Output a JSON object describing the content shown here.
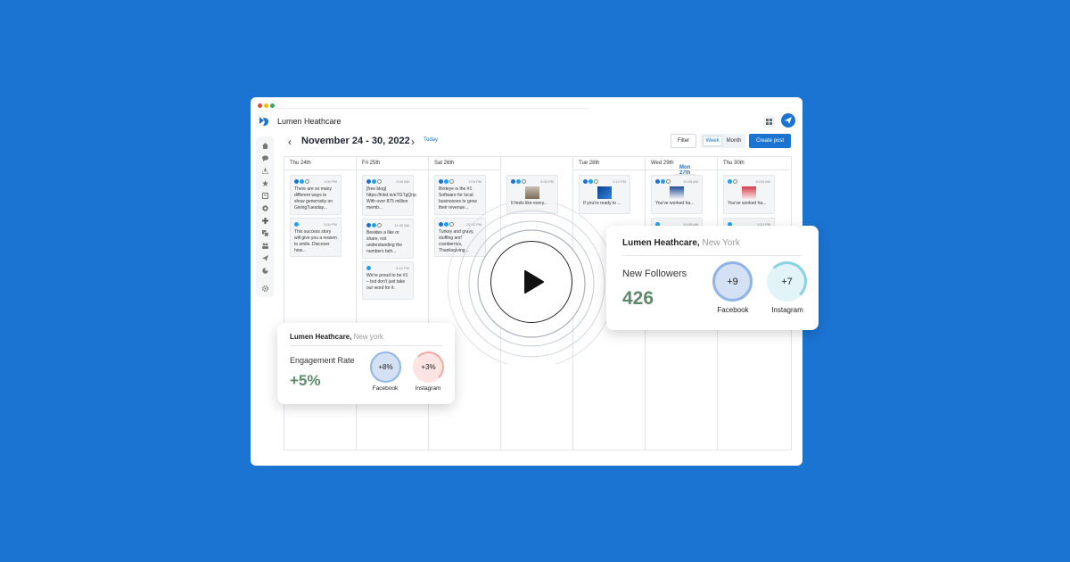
{
  "window": {
    "title": "Lumen Heathcare"
  },
  "toolbar": {
    "date_range": "November 24 - 30, 2022",
    "today_label": "Today",
    "filter_label": "Filter",
    "week_label": "Week",
    "month_label": "Month",
    "create_label": "Create post"
  },
  "days": [
    {
      "label": "Thu  24th"
    },
    {
      "label": "Fri  25th"
    },
    {
      "label": "Sat  26th"
    },
    {
      "label": "Mon  27th"
    },
    {
      "label": "Tue  28th"
    },
    {
      "label": "Wed  29th"
    },
    {
      "label": "Thu  30th"
    }
  ],
  "posts": {
    "thu24_1": {
      "time": "1:00 PM",
      "text": "There are so many different ways to show generosity on GivingTuesday..."
    },
    "thu24_2": {
      "time": "3:00 PM",
      "text": "This success story will give you a reason to smile. Discover how..."
    },
    "fri25_1": {
      "time": "9:00 AM",
      "text": "[free blog] https://lnkd.in/eTGTgQnp With over 875 million memb..."
    },
    "fri25_2": {
      "time": "11:30 AM",
      "text": "Besides a like or share, not understanding the numbers beh..."
    },
    "fri25_3": {
      "time": "3:10 PM",
      "text": "We're proud to be #1 – but don't just take our word for it."
    },
    "sat26_1": {
      "time": "1:09 PM",
      "text": "Birdeye is the #1 Software for local businesses to grow their revenue..."
    },
    "sat26_2": {
      "time": "10:00 PM",
      "text": "Turkey and gravy, stuffing and cranberries, Thanksgiving..."
    },
    "mon27_1": {
      "time": "3:30 PM",
      "text": "It feels like every..."
    },
    "tue28_1": {
      "time": "1:10 PM",
      "text": "If you're ready to ..."
    },
    "wed29_1": {
      "time": "10:08 AM",
      "text": "You've worked ha..."
    },
    "wed29_2": {
      "time": "10:09 AM",
      "text": ""
    },
    "thu30_1": {
      "time": "10:00 AM",
      "text": "You've worked ha..."
    },
    "thu30_2": {
      "time": "1:03 PM",
      "text": ""
    }
  },
  "followers_card": {
    "business": "Lumen Heathcare,",
    "location": " New York",
    "metric_label": "New Followers",
    "metric_value": "426",
    "facebook_value": "+9",
    "facebook_label": "Facebook",
    "instagram_value": "+7",
    "instagram_label": "Instagram"
  },
  "engagement_card": {
    "business": "Lumen Heathcare,",
    "location": " New york",
    "metric_label": "Engagement Rate",
    "metric_value": "+5%",
    "facebook_value": "+8%",
    "facebook_label": "Facebook",
    "instagram_value": "+3%",
    "instagram_label": "Instagram"
  },
  "colors": {
    "background": "#1b74d2",
    "accent": "#1b74d2",
    "metric_green": "#5e8a6a",
    "facebook_ring": "#8fb4e8",
    "instagram_ring_followers": "#86d3e6",
    "instagram_ring_engagement": "#f0a8a0"
  }
}
